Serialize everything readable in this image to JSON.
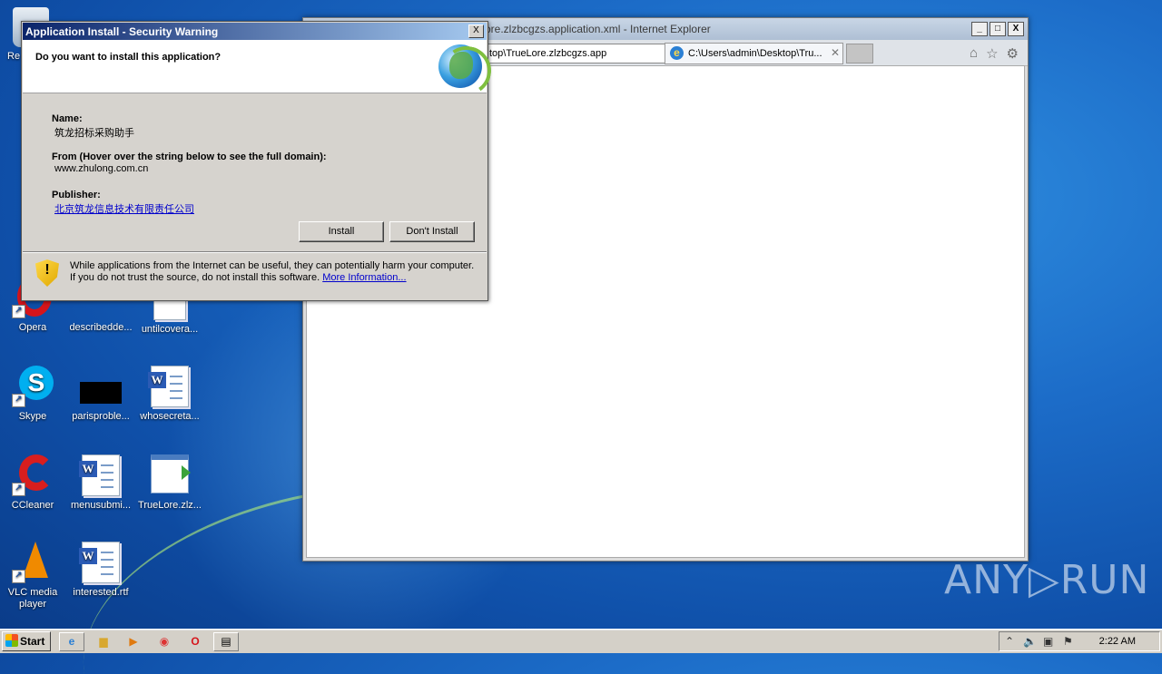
{
  "desktop_icons": [
    {
      "label": "Re",
      "kind": "recycle"
    },
    {
      "label": "Opera",
      "kind": "opera"
    },
    {
      "label": "describedde...",
      "kind": "blank"
    },
    {
      "label": "untilcovera...",
      "kind": "doc"
    },
    {
      "label": "Skype",
      "kind": "skype"
    },
    {
      "label": "parisproble...",
      "kind": "black"
    },
    {
      "label": "whosecreta...",
      "kind": "word"
    },
    {
      "label": "CCleaner",
      "kind": "ccleaner"
    },
    {
      "label": "menusubmi...",
      "kind": "word"
    },
    {
      "label": "TrueLore.zlz...",
      "kind": "app"
    },
    {
      "label": "VLC media player",
      "kind": "vlc"
    },
    {
      "label": "interested.rtf",
      "kind": "word"
    }
  ],
  "ie": {
    "title": "ore.zlzbcgzs.application.xml - Internet Explorer",
    "address": "top\\TrueLore.zlzbcgzs.app",
    "tab_label": "C:\\Users\\admin\\Desktop\\Tru...",
    "win_min": "_",
    "win_max": "□",
    "win_close": "X"
  },
  "dialog": {
    "title": "Application Install - Security Warning",
    "question": "Do you want to install this application?",
    "name_label": "Name:",
    "name_value": "筑龙招标采购助手",
    "from_label": "From (Hover over the string below to see the full domain):",
    "from_value": "www.zhulong.com.cn",
    "publisher_label": "Publisher:",
    "publisher_value": "北京筑龙信息技术有限责任公司",
    "install_label": "Install",
    "dont_install_label": "Don't Install",
    "warning_text": "While applications from the Internet can be useful, they can potentially harm your computer. If you do not trust the source, do not install this software.",
    "more_info_label": "More Information...",
    "close_glyph": "X"
  },
  "taskbar": {
    "start_label": "Start",
    "clock": "2:22 AM"
  },
  "watermark": "ANY▷RUN"
}
